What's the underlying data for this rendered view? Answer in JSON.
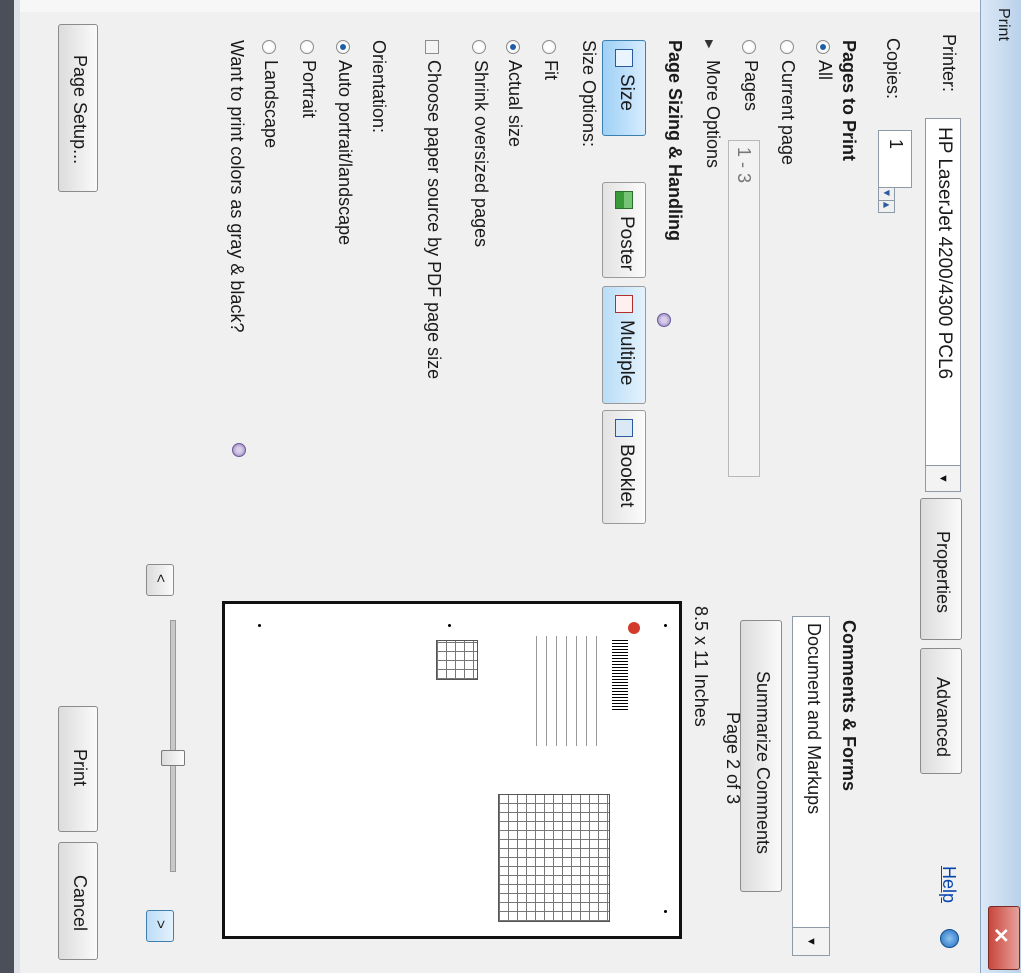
{
  "dialog": {
    "title": "Print",
    "help_label": "Help",
    "close_label": "✕"
  },
  "printer": {
    "label": "Printer:",
    "value": "HP LaserJet 4200/4300 PCL6",
    "properties_label": "Properties",
    "advanced_label": "Advanced"
  },
  "copies": {
    "label": "Copies:",
    "value": "1"
  },
  "pages_to_print": {
    "heading": "Pages to Print",
    "all_label": "All",
    "current_page_label": "Current page",
    "pages_label": "Pages",
    "pages_value": "1 - 3",
    "more_options_label": "More Options",
    "selected": "All"
  },
  "page_sizing": {
    "heading": "Page Sizing & Handling",
    "tabs": [
      {
        "label": "Size",
        "selected": true
      },
      {
        "label": "Poster",
        "selected": false
      },
      {
        "label": "Multiple",
        "selected": false
      },
      {
        "label": "Booklet",
        "selected": false
      }
    ],
    "size_options_label": "Size Options:",
    "fit_label": "Fit",
    "actual_size_label": "Actual size",
    "shrink_label": "Shrink oversized pages",
    "paper_source_label": "Choose paper source by PDF page size",
    "selected_size_option": "Actual size"
  },
  "orientation": {
    "label": "Orientation:",
    "auto_label": "Auto portrait/landscape",
    "portrait_label": "Portrait",
    "landscape_label": "Landscape",
    "selected": "Auto portrait/landscape"
  },
  "gray_question": "Want to print colors as gray & black?",
  "comments_forms": {
    "heading": "Comments & Forms",
    "value": "Document and Markups",
    "summarize_label": "Summarize Comments"
  },
  "preview": {
    "size_label": "8.5 x 11 Inches",
    "page_indicator": "Page 2 of 3",
    "prev_label": "<",
    "next_label": ">"
  },
  "buttons": {
    "page_setup_label": "Page Setup...",
    "print_label": "Print",
    "cancel_label": "Cancel"
  },
  "colors": {
    "titlebar": "#c9dcf0",
    "close_button": "#c9463d",
    "selected_tab": "#9fd0f5",
    "radio_dot": "#1e5da8",
    "help_link": "#0645ad"
  }
}
